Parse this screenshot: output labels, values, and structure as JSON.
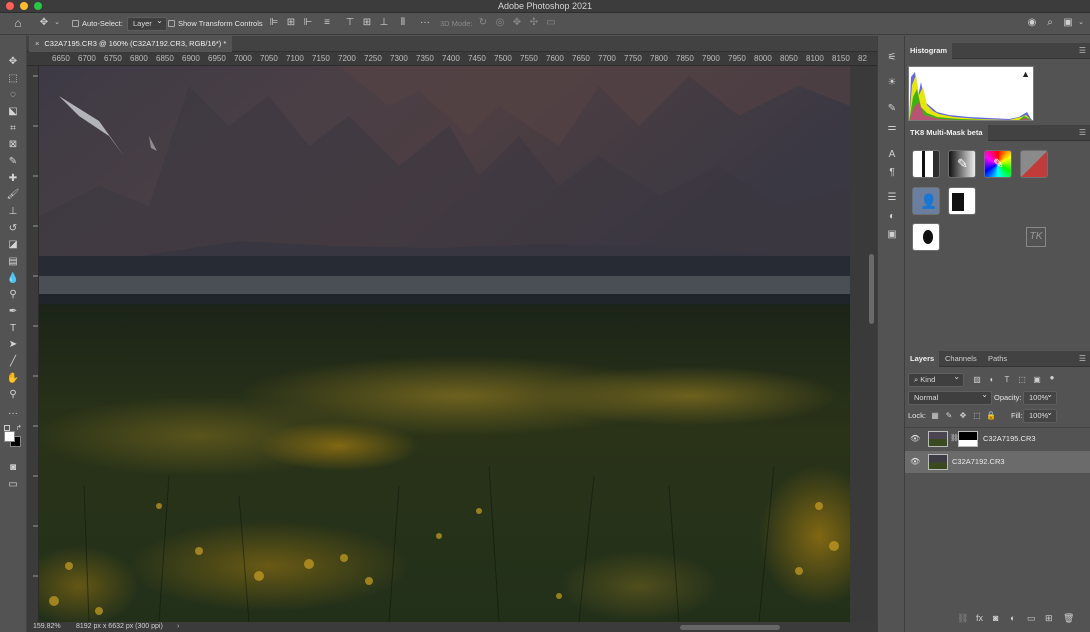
{
  "window": {
    "title": "Adobe Photoshop 2021"
  },
  "options_bar": {
    "auto_select_label": "Auto-Select:",
    "layer_select_value": "Layer",
    "transform_controls_label": "Show Transform Controls",
    "mode_3d_label": "3D Mode:"
  },
  "document": {
    "tab_title": "C32A7195.CR3 @ 160% (C32A7192.CR3, RGB/16*) *",
    "ruler_ticks": [
      "6650",
      "6700",
      "6750",
      "6800",
      "6850",
      "6900",
      "6950",
      "7000",
      "7050",
      "7100",
      "7150",
      "7200",
      "7250",
      "7300",
      "7350",
      "7400",
      "7450",
      "7500",
      "7550",
      "7600",
      "7650",
      "7700",
      "7750",
      "7800",
      "7850",
      "7900",
      "7950",
      "8000",
      "8050",
      "8100",
      "8150",
      "82"
    ]
  },
  "status_bar": {
    "zoom": "159.82%",
    "doc_size": "8192 px x 6632 px (300 ppi)"
  },
  "histogram_panel": {
    "title": "Histogram"
  },
  "tk8_panel": {
    "title": "TK8 Multi-Mask beta"
  },
  "layers_panel": {
    "tabs": [
      "Layers",
      "Channels",
      "Paths"
    ],
    "filter_kind": "Kind",
    "blend_mode": "Normal",
    "opacity_label": "Opacity:",
    "opacity_value": "100%",
    "lock_label": "Lock:",
    "fill_label": "Fill:",
    "fill_value": "100%",
    "layers": [
      {
        "name": "C32A7195.CR3",
        "has_mask": true,
        "selected": false
      },
      {
        "name": "C32A7192.CR3",
        "has_mask": false,
        "selected": true
      }
    ]
  },
  "colors": {
    "ui_background": "#535353",
    "panel_dark": "#424242",
    "selected_layer": "#6b6b6b",
    "close_red": "#ff5f57",
    "minimize_yellow": "#febc2e",
    "zoom_green": "#28c840"
  }
}
